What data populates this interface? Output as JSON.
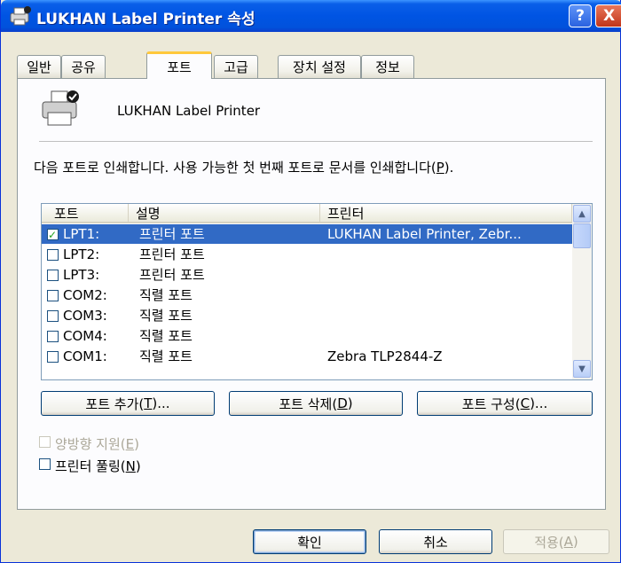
{
  "window": {
    "title": "LUKHAN Label Printer 속성",
    "help_label": "?",
    "close_label": "X"
  },
  "tabs": [
    {
      "label": "일반"
    },
    {
      "label": "공유"
    },
    {
      "label": "포트",
      "active": true
    },
    {
      "label": "고급"
    },
    {
      "label": "장치 설정"
    },
    {
      "label": "정보"
    }
  ],
  "printer": {
    "name": "LUKHAN Label Printer"
  },
  "description": {
    "text": "다음 포트로 인쇄합니다. 사용 가능한 첫 번째 포트로 문서를 인쇄합니다(",
    "mnemonic": "P",
    "suffix": ")."
  },
  "port_list": {
    "columns": [
      "포트",
      "설명",
      "프린터"
    ],
    "rows": [
      {
        "checked": true,
        "port": "LPT1:",
        "desc": "프린터 포트",
        "printer": "LUKHAN Label Printer, Zebr...",
        "selected": true
      },
      {
        "checked": false,
        "port": "LPT2:",
        "desc": "프린터 포트",
        "printer": ""
      },
      {
        "checked": false,
        "port": "LPT3:",
        "desc": "프린터 포트",
        "printer": ""
      },
      {
        "checked": false,
        "port": "COM2:",
        "desc": "직렬 포트",
        "printer": ""
      },
      {
        "checked": false,
        "port": "COM3:",
        "desc": "직렬 포트",
        "printer": ""
      },
      {
        "checked": false,
        "port": "COM4:",
        "desc": "직렬 포트",
        "printer": ""
      },
      {
        "checked": false,
        "port": "COM1:",
        "desc": "직렬 포트",
        "printer": "Zebra TLP2844-Z"
      }
    ]
  },
  "port_buttons": {
    "add": {
      "text": "포트 추가(",
      "mnemonic": "T",
      "suffix": ")..."
    },
    "delete": {
      "text": "포트 삭제(",
      "mnemonic": "D",
      "suffix": ")"
    },
    "configure": {
      "text": "포트 구성(",
      "mnemonic": "C",
      "suffix": ")..."
    }
  },
  "options": {
    "bidirectional": {
      "text": "양방향 지원(",
      "mnemonic": "E",
      "suffix": ")",
      "enabled": false
    },
    "pooling": {
      "text": "프린터 풀링(",
      "mnemonic": "N",
      "suffix": ")",
      "enabled": true
    }
  },
  "dialog_buttons": {
    "ok": "확인",
    "cancel": "취소",
    "apply": {
      "text": "적용(",
      "mnemonic": "A",
      "suffix": ")"
    }
  },
  "colors": {
    "title_bar": "#0054e3",
    "selection": "#316ac5",
    "tab_highlight": "#ffc83c"
  }
}
